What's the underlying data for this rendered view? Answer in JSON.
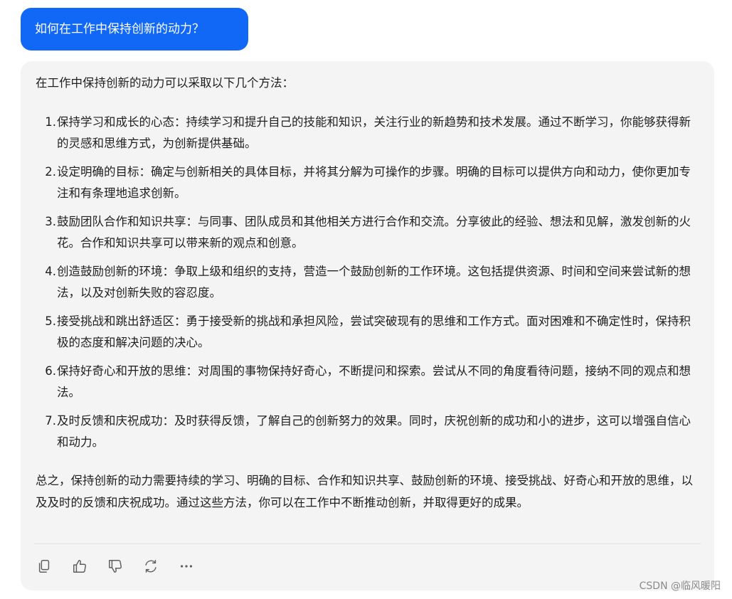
{
  "user_message": {
    "text": "如何在工作中保持创新的动力？"
  },
  "answer": {
    "intro": "在工作中保持创新的动力可以采取以下几个方法：",
    "steps": [
      {
        "num": "1.",
        "text": "保持学习和成长的心态：持续学习和提升自己的技能和知识，关注行业的新趋势和技术发展。通过不断学习，你能够获得新的灵感和思维方式，为创新提供基础。"
      },
      {
        "num": "2.",
        "text": "设定明确的目标：确定与创新相关的具体目标，并将其分解为可操作的步骤。明确的目标可以提供方向和动力，使你更加专注和有条理地追求创新。"
      },
      {
        "num": "3.",
        "text": "鼓励团队合作和知识共享：与同事、团队成员和其他相关方进行合作和交流。分享彼此的经验、想法和见解，激发创新的火花。合作和知识共享可以带来新的观点和创意。"
      },
      {
        "num": "4.",
        "text": "创造鼓励创新的环境：争取上级和组织的支持，营造一个鼓励创新的工作环境。这包括提供资源、时间和空间来尝试新的想法，以及对创新失败的容忍度。"
      },
      {
        "num": "5.",
        "text": "接受挑战和跳出舒适区：勇于接受新的挑战和承担风险，尝试突破现有的思维和工作方式。面对困难和不确定性时，保持积极的态度和解决问题的决心。"
      },
      {
        "num": "6.",
        "text": "保持好奇心和开放的思维：对周围的事物保持好奇心，不断提问和探索。尝试从不同的角度看待问题，接纳不同的观点和想法。"
      },
      {
        "num": "7.",
        "text": "及时反馈和庆祝成功：及时获得反馈，了解自己的创新努力的效果。同时，庆祝创新的成功和小的进步，这可以增强自信心和动力。"
      }
    ],
    "summary": "总之，保持创新的动力需要持续的学习、明确的目标、合作和知识共享、鼓励创新的环境、接受挑战、好奇心和开放的思维，以及及时的反馈和庆祝成功。通过这些方法，你可以在工作中不断推动创新，并取得更好的成果。"
  },
  "actions": [
    {
      "icon": "copy-icon"
    },
    {
      "icon": "thumbs-up-icon"
    },
    {
      "icon": "thumbs-down-icon"
    },
    {
      "icon": "regenerate-icon"
    },
    {
      "icon": "more-icon"
    }
  ],
  "watermark": "CSDN @临风暖阳"
}
